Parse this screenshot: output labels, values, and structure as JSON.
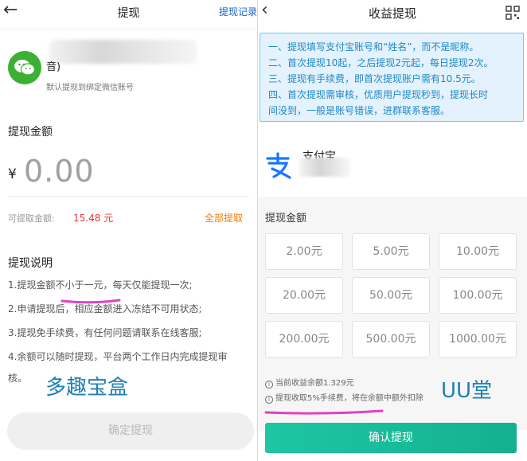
{
  "left": {
    "header": {
      "back_glyph": "←",
      "title": "提现",
      "records_label": "提现记录"
    },
    "wechat": {
      "icon": "wechat-icon",
      "name_fragment": "音)",
      "subtitle": "默认提现到绑定微信账号"
    },
    "amount": {
      "label": "提现金额",
      "currency": "¥",
      "value": "0.00"
    },
    "available": {
      "label": "可提取金额:",
      "value": "15.48 元",
      "withdraw_all": "全部提取"
    },
    "notes": {
      "title": "提现说明",
      "items": [
        "1.提现金额不小于一元，每天仅能提现一次;",
        "2.申请提现后，相应金额进入冻结不可用状态;",
        "3.提现免手续费，有任何问题请联系在线客服;",
        "4.余额可以随时提现，平台两个工作日内完成提现审",
        "核。"
      ]
    },
    "watermark": "多趣宝盒",
    "confirm_label": "确定提现"
  },
  "right": {
    "header": {
      "back_glyph": "‹",
      "title": "收益提现",
      "scan_icon": "scan-icon"
    },
    "notice": [
      "一、提现填写支付宝账号和“姓名”，而不是昵称。",
      "二、首次提现10起，之后提现2元起，每日提现2次。",
      "三、提现有手续费，即首次提现账户需有10.5元。",
      "四、首次提现需审核，优质用户提现秒到，提现长时",
      "间没到，一般是账号错误，进群联系客服。"
    ],
    "alipay": {
      "icon": "alipay-icon",
      "name": "支付宝"
    },
    "amount_label": "提现金额",
    "tiles": [
      "2.00元",
      "5.00元",
      "10.00元",
      "20.00元",
      "50.00元",
      "100.00元",
      "200.00元",
      "500.00元",
      "1000.00元"
    ],
    "info": [
      "当前收益余额1.329元",
      "提现收取5%手续费，将在余额中额外扣除"
    ],
    "watermark": "UU堂",
    "confirm_label": "确认提现"
  },
  "colors": {
    "accent_blue": "#1565c0",
    "alert_red": "#e53935",
    "orange": "#f57c00",
    "teal_button": "#14b08f",
    "wechat_green": "#3cb035",
    "alipay_blue": "#1677ff",
    "highlight_pink": "#e040c8"
  }
}
